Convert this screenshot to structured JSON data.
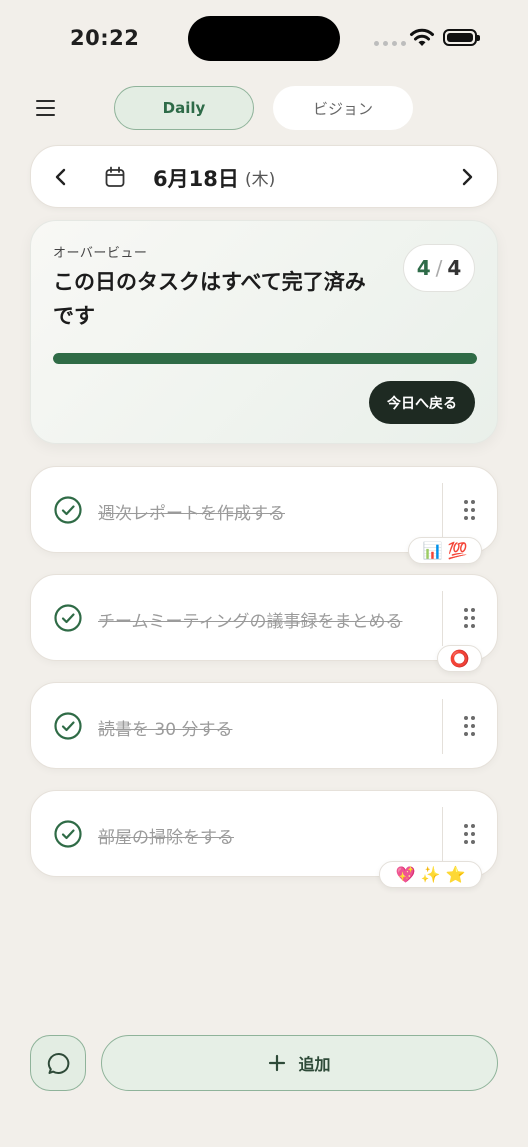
{
  "status_bar": {
    "time": "20:22"
  },
  "nav": {
    "tabs": [
      {
        "label": "Daily",
        "active": true
      },
      {
        "label": "ビジョン",
        "active": false
      }
    ]
  },
  "date_bar": {
    "date": "6月18日",
    "weekday": "(木)"
  },
  "overview": {
    "label": "オーバービュー",
    "title": "この日のタスクはすべて完了済みです",
    "done": "4",
    "total": "4",
    "progress_fraction": 1.0,
    "back_button": "今日へ戻る"
  },
  "tasks": [
    {
      "text": "週次レポートを作成する",
      "done": true,
      "reactions": "📊 💯"
    },
    {
      "text": "チームミーティングの議事録をまとめる",
      "done": true,
      "reactions": "⭕"
    },
    {
      "text": "読書を 30 分する",
      "done": true,
      "reactions": ""
    },
    {
      "text": "部屋の掃除をする",
      "done": true,
      "reactions": "💖 ✨ ⭐"
    }
  ],
  "bottom": {
    "add_label": "追加"
  },
  "colors": {
    "accent": "#2f6b46",
    "background": "#f2efea",
    "dark_button": "#1e2a22"
  }
}
